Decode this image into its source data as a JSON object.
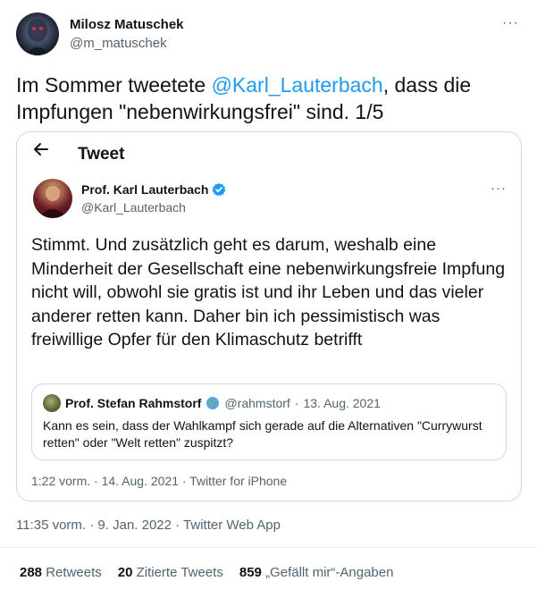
{
  "tweet": {
    "author_name": "Milosz Matuschek",
    "author_handle": "@m_matuschek",
    "more_label": "···",
    "text_before": "Im Sommer tweetete ",
    "mention": "@Karl_Lauterbach",
    "text_after": ", dass die Impfungen \"nebenwirkungsfrei\" sind. 1/5",
    "timestamp": "11:35 vorm. · 9. Jan. 2022 · Twitter Web App"
  },
  "quoted": {
    "header_title": "Tweet",
    "back_icon": "arrow-left-icon",
    "author_name": "Prof. Karl Lauterbach",
    "author_handle": "@Karl_Lauterbach",
    "verified_color": "#1d9bf0",
    "more_label": "···",
    "text": "Stimmt. Und zusätzlich geht es darum, weshalb eine Minderheit der Gesellschaft eine nebenwirkungsfreie Impfung nicht will, obwohl sie gratis ist und ihr Leben und das vieler anderer retten kann. Daher bin ich pessimistisch was freiwillige Opfer für den Klimaschutz betrifft",
    "timestamp": "1:22 vorm. · 14. Aug. 2021 · Twitter for iPhone",
    "nested": {
      "author_name": "Prof. Stefan Rahmstorf",
      "author_handle": "@rahmstorf",
      "date": "13. Aug. 2021",
      "separator": "·",
      "text": "Kann es sein, dass der Wahlkampf sich gerade auf die Alternativen \"Currywurst retten\" oder \"Welt retten\" zuspitzt?"
    }
  },
  "stats": {
    "retweets_count": "288",
    "retweets_label": "Retweets",
    "quotes_count": "20",
    "quotes_label": "Zitierte Tweets",
    "likes_count": "859",
    "likes_label": "„Gefällt mir“-Angaben"
  },
  "colors": {
    "link": "#1d9bf0",
    "text": "#0f1419",
    "secondary": "#536471",
    "border": "#cfd9de"
  }
}
